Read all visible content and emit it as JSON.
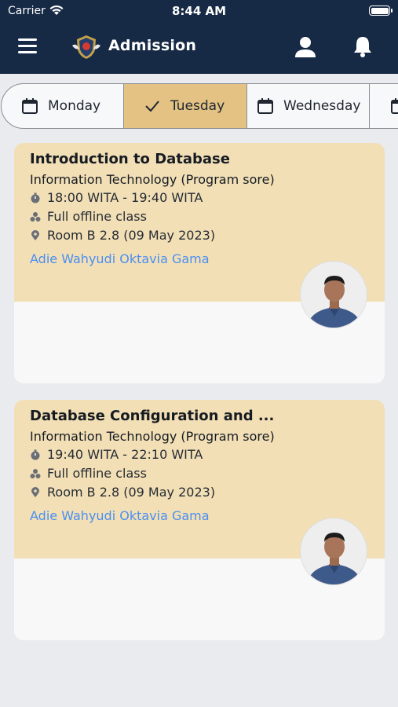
{
  "status": {
    "carrier": "Carrier",
    "time": "8:44 AM"
  },
  "header": {
    "title": "Admission",
    "icons": [
      "menu-icon",
      "logo",
      "user-icon",
      "bell-icon"
    ]
  },
  "tabs": [
    {
      "label": "Monday",
      "icon": "calendar-icon",
      "selected": false
    },
    {
      "label": "Tuesday",
      "icon": "check-icon",
      "selected": true
    },
    {
      "label": "Wednesday",
      "icon": "calendar-icon",
      "selected": false
    },
    {
      "label": "",
      "icon": "calendar-icon",
      "selected": false
    }
  ],
  "courses": [
    {
      "title": "Introduction to Database",
      "program": "Information Technology (Program sore)",
      "time": "18:00 WITA - 19:40 WITA",
      "mode": "Full offline class",
      "room": "Room B 2.8 (09 May 2023)",
      "lecturer": "Adie Wahyudi Oktavia Gama"
    },
    {
      "title": "Database Configuration and ...",
      "program": "Information Technology (Program sore)",
      "time": "19:40 WITA - 22:10 WITA",
      "mode": "Full offline class",
      "room": "Room B 2.8 (09 May 2023)",
      "lecturer": "Adie Wahyudi Oktavia Gama"
    }
  ],
  "colors": {
    "header": "#172a45",
    "selected_tab": "#e3c284",
    "card_top": "#f2dfb6",
    "link": "#4a8ff0"
  }
}
